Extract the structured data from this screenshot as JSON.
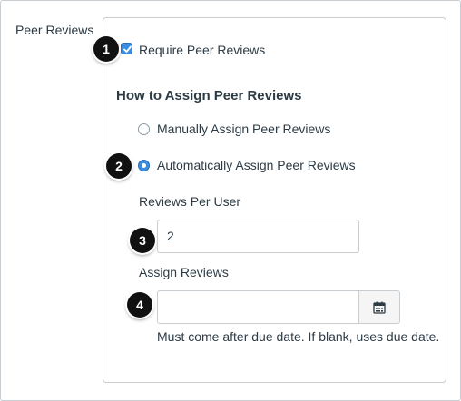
{
  "section": {
    "label": "Peer Reviews"
  },
  "markers": [
    "1",
    "2",
    "3",
    "4"
  ],
  "require_peer_reviews": {
    "label": "Require Peer Reviews",
    "checked": true
  },
  "assign": {
    "heading": "How to Assign Peer Reviews",
    "options": [
      {
        "label": "Manually Assign Peer Reviews",
        "selected": false
      },
      {
        "label": "Automatically Assign Peer Reviews",
        "selected": true
      }
    ]
  },
  "reviews_per_user": {
    "label": "Reviews Per User",
    "value": "2"
  },
  "assign_reviews": {
    "label": "Assign Reviews",
    "value": "",
    "calendar_icon": "calendar-icon",
    "hint": "Must come after due date. If blank, uses due date."
  },
  "colors": {
    "accent": "#3b8de3",
    "marker": "#111111",
    "border": "#c7cdd1",
    "text": "#2d3b45"
  }
}
